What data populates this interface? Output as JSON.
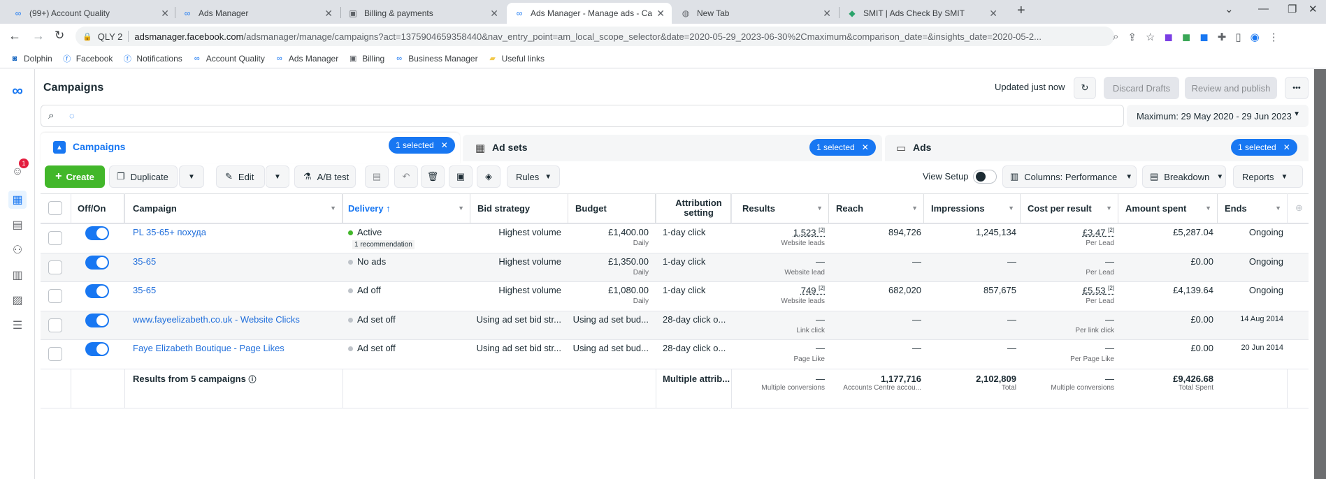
{
  "browser": {
    "tabs": [
      {
        "title": "(99+) Account Quality",
        "icon": "meta-icon",
        "active": false
      },
      {
        "title": "Ads Manager",
        "icon": "meta-icon",
        "active": false
      },
      {
        "title": "Billing & payments",
        "icon": "billing-icon",
        "active": false
      },
      {
        "title": "Ads Manager - Manage ads - Ca",
        "icon": "meta-icon",
        "active": true
      },
      {
        "title": "New Tab",
        "icon": "chrome-icon",
        "active": false
      },
      {
        "title": "SMIT | Ads Check By SMIT",
        "icon": "smit-icon",
        "active": false
      }
    ],
    "new_tab": "+",
    "profile_label": "QLY 2",
    "url_host": "adsmanager.facebook.com",
    "url_path": "/adsmanager/manage/campaigns?act=1375904659358440&nav_entry_point=am_local_scope_selector&date=2020-05-29_2023-06-30%2Cmaximum&comparison_date=&insights_date=2020-05-2...",
    "bookmarks": [
      {
        "label": "Dolphin",
        "icon": "dolphin-icon"
      },
      {
        "label": "Facebook",
        "icon": "facebook-icon"
      },
      {
        "label": "Notifications",
        "icon": "facebook-icon"
      },
      {
        "label": "Account Quality",
        "icon": "meta-icon"
      },
      {
        "label": "Ads Manager",
        "icon": "meta-icon"
      },
      {
        "label": "Billing",
        "icon": "billing-icon"
      },
      {
        "label": "Business Manager",
        "icon": "meta-icon"
      },
      {
        "label": "Useful links",
        "icon": "folder-icon"
      }
    ]
  },
  "header": {
    "title": "Campaigns",
    "updated": "Updated just now",
    "discard": "Discard Drafts",
    "review": "Review and publish",
    "more": "•••"
  },
  "search": {
    "date_range": "Maximum: 29 May 2020 - 29 Jun 2023"
  },
  "levels": {
    "campaigns": "Campaigns",
    "adsets": "Ad sets",
    "ads": "Ads",
    "selected": "1 selected"
  },
  "actions": {
    "create": "Create",
    "duplicate": "Duplicate",
    "edit": "Edit",
    "abtest": "A/B test",
    "rules": "Rules",
    "view_setup": "View Setup",
    "columns": "Columns: Performance",
    "breakdown": "Breakdown",
    "reports": "Reports"
  },
  "notification_count": "1",
  "columns": {
    "offon": "Off/On",
    "campaign": "Campaign",
    "delivery": "Delivery ↑",
    "bid": "Bid strategy",
    "budget": "Budget",
    "attribution": "Attribution setting",
    "results": "Results",
    "reach": "Reach",
    "impressions": "Impressions",
    "cpr": "Cost per result",
    "spent": "Amount spent",
    "ends": "Ends"
  },
  "rows": [
    {
      "campaign": "PL 35-65+ похуда",
      "delivery": "Active",
      "delivery_sub": "1 recommendation",
      "dot": "#42b72a",
      "bid": "Highest volume",
      "budget": "£1,400.00",
      "budget_sub": "Daily",
      "attribution": "1-day click",
      "results": "1,523",
      "results_sub": "Website leads",
      "reach": "894,726",
      "impressions": "1,245,134",
      "cpr": "£3.47",
      "cpr_sub": "Per Lead",
      "spent": "£5,287.04",
      "ends": "Ongoing"
    },
    {
      "campaign": "35-65",
      "delivery": "No ads",
      "delivery_sub": "",
      "dot": "#bec3c9",
      "bid": "Highest volume",
      "budget": "£1,350.00",
      "budget_sub": "Daily",
      "attribution": "1-day click",
      "results": "—",
      "results_sub": "Website lead",
      "reach": "—",
      "impressions": "—",
      "cpr": "—",
      "cpr_sub": "Per Lead",
      "spent": "£0.00",
      "ends": "Ongoing"
    },
    {
      "campaign": "35-65",
      "delivery": "Ad off",
      "delivery_sub": "",
      "dot": "#bec3c9",
      "bid": "Highest volume",
      "budget": "£1,080.00",
      "budget_sub": "Daily",
      "attribution": "1-day click",
      "results": "749",
      "results_sub": "Website leads",
      "reach": "682,020",
      "impressions": "857,675",
      "cpr": "£5.53",
      "cpr_sub": "Per Lead",
      "spent": "£4,139.64",
      "ends": "Ongoing"
    },
    {
      "campaign": "www.fayeelizabeth.co.uk - Website Clicks",
      "delivery": "Ad set off",
      "delivery_sub": "",
      "dot": "#bec3c9",
      "bid": "Using ad set bid str...",
      "budget": "Using ad set bud...",
      "budget_sub": "",
      "attribution": "28-day click o...",
      "results": "—",
      "results_sub": "Link click",
      "reach": "—",
      "impressions": "—",
      "cpr": "—",
      "cpr_sub": "Per link click",
      "spent": "£0.00",
      "ends": "14 Aug 2014"
    },
    {
      "campaign": "Faye Elizabeth Boutique - Page Likes",
      "delivery": "Ad set off",
      "delivery_sub": "",
      "dot": "#bec3c9",
      "bid": "Using ad set bid str...",
      "budget": "Using ad set bud...",
      "budget_sub": "",
      "attribution": "28-day click o...",
      "results": "—",
      "results_sub": "Page Like",
      "reach": "—",
      "impressions": "—",
      "cpr": "—",
      "cpr_sub": "Per Page Like",
      "spent": "£0.00",
      "ends": "20 Jun 2014"
    }
  ],
  "totals": {
    "label": "Results from 5 campaigns",
    "attribution": "Multiple attrib...",
    "results": "—",
    "results_sub": "Multiple conversions",
    "reach": "1,177,716",
    "reach_sub": "Accounts Centre accou...",
    "impressions": "2,102,809",
    "impressions_sub": "Total",
    "cpr": "—",
    "cpr_sub": "Multiple conversions",
    "spent": "£9,426.68",
    "spent_sub": "Total Spent"
  }
}
